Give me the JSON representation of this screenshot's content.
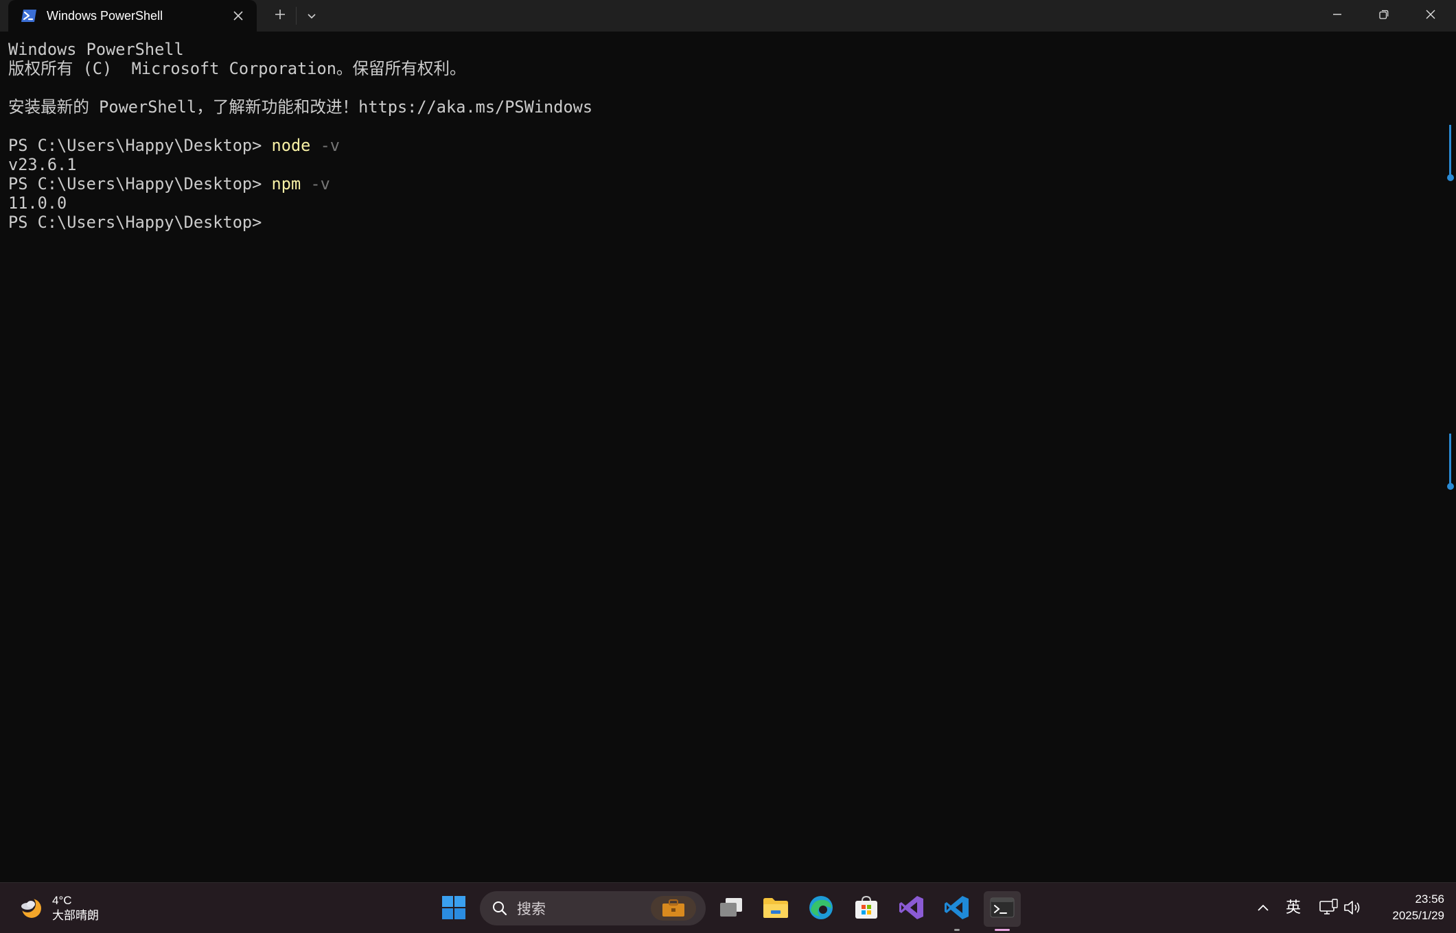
{
  "window": {
    "tab_title": "Windows PowerShell",
    "icons": {
      "tab": "powershell-icon",
      "close_tab": "close-icon",
      "new_tab": "plus-icon",
      "dropdown": "chevron-down-icon",
      "minimize": "minimize-icon",
      "maximize": "restore-icon",
      "close": "close-icon"
    }
  },
  "terminal": {
    "banner_1": "Windows PowerShell",
    "banner_2": "版权所有 (C)  Microsoft Corporation。保留所有权利。",
    "banner_3": "安装最新的 PowerShell，了解新功能和改进！https://aka.ms/PSWindows",
    "prompt": "PS C:\\Users\\Happy\\Desktop> ",
    "final_prompt": "PS C:\\Users\\Happy\\Desktop>",
    "commands": [
      {
        "cmd": "node",
        "param": " -v",
        "output": "v23.6.1"
      },
      {
        "cmd": "npm",
        "param": " -v",
        "output": "11.0.0"
      }
    ]
  },
  "taskbar": {
    "weather_temp": "4°C",
    "weather_desc": "大部晴朗",
    "search_placeholder": "搜索",
    "language": "英",
    "time": "23:56",
    "date": "2025/1/29",
    "apps": [
      "start",
      "task-view",
      "file-explorer",
      "edge",
      "microsoft-store",
      "visual-studio",
      "vscode",
      "terminal"
    ]
  },
  "colors": {
    "terminal_bg": "#0c0c0c",
    "terminal_text": "#cccccc",
    "command": "#f9f1a5",
    "parameter": "#767676",
    "titlebar": "#202020",
    "taskbar": "#241b20",
    "scroll_mark": "#2a8bd5"
  }
}
